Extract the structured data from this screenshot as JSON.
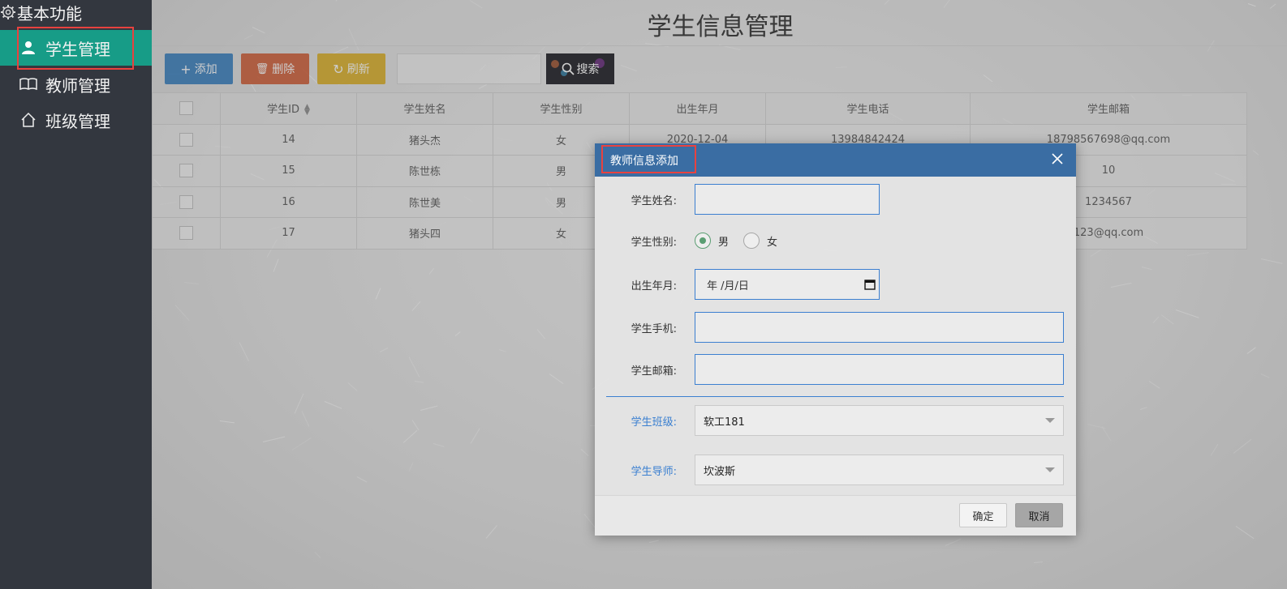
{
  "sidebar": {
    "section_title": "基本功能",
    "items": [
      {
        "label": "学生管理",
        "icon": "user-icon",
        "active": true
      },
      {
        "label": "教师管理",
        "icon": "book-icon",
        "active": false
      },
      {
        "label": "班级管理",
        "icon": "home-icon",
        "active": false
      }
    ]
  },
  "page": {
    "title": "学生信息管理"
  },
  "toolbar": {
    "add_label": "添加",
    "delete_label": "删除",
    "refresh_label": "刷新",
    "search_placeholder": "",
    "search_label": "搜索"
  },
  "table": {
    "columns": [
      "学生ID",
      "学生姓名",
      "学生性别",
      "出生年月",
      "学生电话",
      "学生邮箱"
    ],
    "rows": [
      {
        "id": "14",
        "name": "猪头杰",
        "gender": "女",
        "birth": "2020-12-04",
        "phone": "13984842424",
        "email": "18798567698@qq.com"
      },
      {
        "id": "15",
        "name": "陈世栋",
        "gender": "男",
        "birth": "",
        "phone": "",
        "email": "10"
      },
      {
        "id": "16",
        "name": "陈世美",
        "gender": "男",
        "birth": "",
        "phone": "",
        "email": "1234567"
      },
      {
        "id": "17",
        "name": "猪头四",
        "gender": "女",
        "birth": "",
        "phone": "",
        "email": "123@qq.com"
      }
    ]
  },
  "dialog": {
    "title": "教师信息添加",
    "fields": {
      "name_label": "学生姓名:",
      "name_value": "",
      "gender_label": "学生性别:",
      "gender_options": [
        "男",
        "女"
      ],
      "gender_selected": "男",
      "birth_label": "出生年月:",
      "birth_value": "年 /月/日",
      "phone_label": "学生手机:",
      "phone_value": "",
      "email_label": "学生邮箱:",
      "email_value": "",
      "class_label": "学生班级:",
      "class_value": "软工181",
      "tutor_label": "学生导师:",
      "tutor_value": "坎波斯"
    },
    "ok_label": "确定",
    "cancel_label": "取消"
  },
  "colors": {
    "sidebar_bg": "#33373f",
    "active_item": "#179c87",
    "dialog_header": "#3a6da3",
    "add_button": "#1e6fb8",
    "delete_button": "#cc4a1e",
    "refresh_button": "#d7a50a",
    "highlight_box": "#e8423f"
  }
}
